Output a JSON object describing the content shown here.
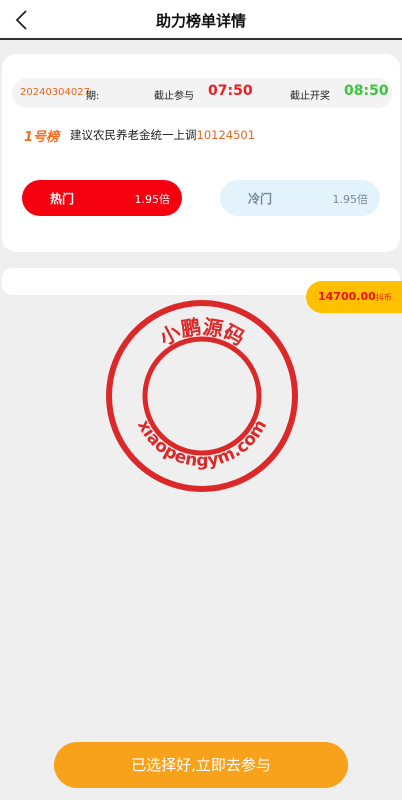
{
  "header": {
    "title": "助力榜单详情",
    "back_icon": "chevron-left-icon"
  },
  "period": {
    "id": "20240304027",
    "suffix": "期:",
    "deadline_label": "截止参与",
    "deadline_time": "07:50",
    "draw_label": "截止开奖",
    "draw_time": "08:50"
  },
  "ranking": {
    "name": "1号榜",
    "text": "建议农民养老金统一上调",
    "code": "10124501"
  },
  "options": {
    "hot_label": "热门",
    "hot_odds": "1.95倍",
    "cold_label": "冷门",
    "cold_odds": "1.95倍"
  },
  "balance": {
    "amount": "14700.00",
    "unit": "抖币"
  },
  "watermark": {
    "top_text": "小鹏源码",
    "bottom_text": "xiaopengym.com"
  },
  "cta_label": "已选择好,立即去参与",
  "colors": {
    "hot": "#f4000f",
    "cold_bg": "#e2f3fc",
    "accent_orange": "#e8641e",
    "deadline_red": "#ef1c1c",
    "draw_green": "#3ac63a",
    "badge_yellow": "#fec000",
    "cta_orange": "#f8a11b",
    "stamp_red": "#d90d0d"
  }
}
